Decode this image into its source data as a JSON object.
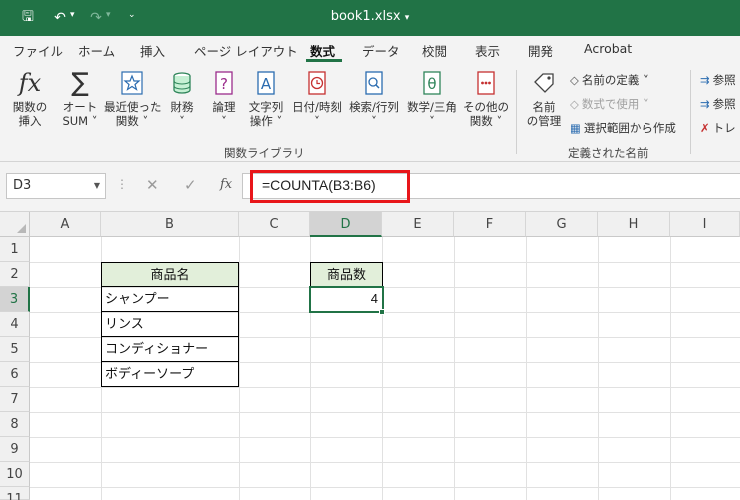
{
  "titlebar": {
    "title": "book1.xlsx",
    "title_caret": "▾",
    "save_glyph": "🖫",
    "undo_glyph": "↶",
    "redo_glyph": "↷",
    "caret": "▾",
    "customize_glyph": "⌄"
  },
  "tabs": [
    {
      "label": "ファイル"
    },
    {
      "label": "ホーム"
    },
    {
      "label": "挿入"
    },
    {
      "label": "ページ レイアウト"
    },
    {
      "label": "数式"
    },
    {
      "label": "データ"
    },
    {
      "label": "校閲"
    },
    {
      "label": "表示"
    },
    {
      "label": "開発"
    },
    {
      "label": "Acrobat"
    }
  ],
  "ribbon": {
    "insert_function": {
      "line1": "関数の",
      "line2": "挿入"
    },
    "autosum": {
      "line1": "オート",
      "line2": "SUM ˅"
    },
    "recent": {
      "line1": "最近使った",
      "line2": "関数 ˅"
    },
    "financial": {
      "line1": "財務",
      "line2": "˅"
    },
    "logical": {
      "line1": "論理",
      "line2": "˅"
    },
    "text": {
      "line1": "文字列",
      "line2": "操作 ˅"
    },
    "datetime": {
      "line1": "日付/時刻",
      "line2": "˅"
    },
    "lookup": {
      "line1": "検索/行列",
      "line2": "˅"
    },
    "math": {
      "line1": "数学/三角",
      "line2": "˅"
    },
    "more": {
      "line1": "その他の",
      "line2": "関数 ˅"
    },
    "group_function_library": "関数ライブラリ",
    "name_manager": {
      "line1": "名前",
      "line2": "の管理"
    },
    "define_name": "名前の定義 ˅",
    "use_in_formula": "数式で使用 ˅",
    "create_from_selection": "選択範囲から作成",
    "group_defined_names": "定義された名前",
    "trace_precedents": "参照",
    "trace_dependents": "参照",
    "remove_arrows": "トレ"
  },
  "formula_bar": {
    "name_box": "D3",
    "formula": "=COUNTA(B3:B6)",
    "fx": "fx",
    "cancel": "✕",
    "enter": "✓",
    "dots": "⋮"
  },
  "sheet": {
    "columns": [
      "A",
      "B",
      "C",
      "D",
      "E",
      "F",
      "G",
      "H",
      "I"
    ],
    "rows": [
      "1",
      "2",
      "3",
      "4",
      "5",
      "6",
      "7",
      "8",
      "9",
      "10",
      "11"
    ],
    "b2": "商品名",
    "b3": "シャンプー",
    "b4": "リンス",
    "b5": "コンディショナー",
    "b6": "ボディーソープ",
    "d2": "商品数",
    "d3": "4"
  }
}
